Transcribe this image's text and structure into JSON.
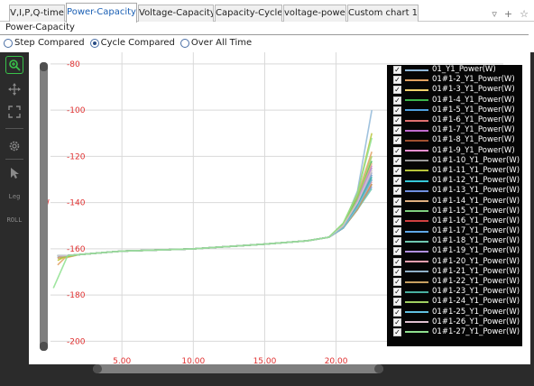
{
  "tabs": [
    "V,I,P,Q-time",
    "Power-Capacity",
    "Voltage-Capacity",
    "Capacity-Cycle",
    "voltage-power",
    "Custom chart 1"
  ],
  "active_tab": 1,
  "tab_tools": {
    "filter": "▿",
    "add": "+",
    "star": "☆"
  },
  "subtitle": "Power-Capacity",
  "radios": [
    {
      "label": "Step Compared",
      "checked": false
    },
    {
      "label": "Cycle Compared",
      "checked": true
    },
    {
      "label": "Over All Time",
      "checked": false
    }
  ],
  "toolbar": {
    "legend_label": "Leg",
    "roll_label": "ROLL"
  },
  "y_axis_label": "W",
  "colors": {
    "axis_label": "#e03030",
    "grid": "#d9d9d9",
    "legend_bg": "#050505",
    "zoom_tool": "#39c24a"
  },
  "chart_data": {
    "type": "line",
    "ylabel": "W",
    "xlim": [
      0,
      23.5
    ],
    "ylim": [
      -210,
      -75
    ],
    "x_ticks": [
      "5.00",
      "10.00",
      "15.00",
      "20.00"
    ],
    "y_ticks": [
      "-80",
      "-100",
      "-120",
      "-140",
      "-160",
      "-180",
      "-200"
    ],
    "series": [
      {
        "name": "01_Y1_Power(W)",
        "color": "#8fb7d8",
        "x": [
          0.5,
          1,
          2,
          5,
          10,
          15,
          18,
          19.5,
          20.5,
          21.5,
          22.5
        ],
        "y": [
          -163.5,
          -163,
          -162.5,
          -161,
          -160,
          -158,
          -156.5,
          -155,
          -150,
          -135,
          -100
        ]
      },
      {
        "name": "01#1-2_Y1_Power(W)",
        "color": "#e0a060",
        "x": [
          0.5,
          1,
          2,
          5,
          10,
          15,
          18,
          19.5,
          20.5,
          21.5,
          22.5
        ],
        "y": [
          -167,
          -164,
          -162.5,
          -161,
          -160,
          -158,
          -156.5,
          -155,
          -150,
          -137,
          -118
        ]
      },
      {
        "name": "01#1-3_Y1_Power(W)",
        "color": "#f2d16b",
        "x": [
          0.5,
          1,
          2,
          5,
          10,
          15,
          18,
          19.5,
          20.5,
          21.5,
          22.5
        ],
        "y": [
          -165,
          -163.5,
          -162.5,
          -161,
          -160,
          -158,
          -156.5,
          -155,
          -151,
          -140,
          -125
        ]
      },
      {
        "name": "01#1-4_Y1_Power(W)",
        "color": "#3cb44b",
        "x": [
          0.5,
          1,
          2,
          5,
          10,
          15,
          18,
          19.5,
          20.5,
          21.5,
          22.5
        ],
        "y": [
          -164,
          -163.5,
          -162.5,
          -161,
          -160,
          -158,
          -156.5,
          -155,
          -149,
          -138,
          -122
        ]
      },
      {
        "name": "01#1-5_Y1_Power(W)",
        "color": "#4fa0e0",
        "x": [
          0.5,
          1,
          2,
          5,
          10,
          15,
          18,
          19.5,
          20.5,
          21.5,
          22.5
        ],
        "y": [
          -163,
          -163,
          -162.5,
          -161,
          -160,
          -158,
          -156.5,
          -155,
          -150,
          -141,
          -130
        ]
      },
      {
        "name": "01#1-6_Y1_Power(W)",
        "color": "#e07070",
        "x": [
          0.5,
          1,
          2,
          5,
          10,
          15,
          18,
          19.5,
          20.5,
          21.5,
          22.5
        ],
        "y": [
          -163,
          -163,
          -162.5,
          -161,
          -160,
          -158,
          -156.5,
          -155,
          -151,
          -142,
          -128
        ]
      },
      {
        "name": "01#1-7_Y1_Power(W)",
        "color": "#c06bd0",
        "x": [
          0.5,
          1,
          2,
          5,
          10,
          15,
          18,
          19.5,
          20.5,
          21.5,
          22.5
        ],
        "y": [
          -164,
          -163,
          -162.5,
          -161,
          -160,
          -158,
          -156.5,
          -155,
          -150,
          -139,
          -124
        ]
      },
      {
        "name": "01#1-8_Y1_Power(W)",
        "color": "#a05030",
        "x": [
          0.5,
          1,
          2,
          5,
          10,
          15,
          18,
          19.5,
          20.5,
          21.5,
          22.5
        ],
        "y": [
          -164,
          -163,
          -162.5,
          -161,
          -160,
          -158,
          -156.5,
          -155,
          -151,
          -143,
          -132
        ]
      },
      {
        "name": "01#1-9_Y1_Power(W)",
        "color": "#f08fd0",
        "x": [
          0.5,
          1,
          2,
          5,
          10,
          15,
          18,
          19.5,
          20.5,
          21.5,
          22.5
        ],
        "y": [
          -163,
          -163,
          -162.5,
          -161,
          -160,
          -158,
          -156.5,
          -155,
          -150,
          -140,
          -127
        ]
      },
      {
        "name": "01#1-10_Y1_Power(W)",
        "color": "#9a9a9a",
        "x": [
          0.5,
          1,
          2,
          5,
          10,
          15,
          18,
          19.5,
          20.5,
          21.5,
          22.5
        ],
        "y": [
          -163,
          -163,
          -162.5,
          -161,
          -160,
          -158,
          -156.5,
          -155,
          -151,
          -142,
          -131
        ]
      },
      {
        "name": "01#1-11_Y1_Power(W)",
        "color": "#b8c43a",
        "x": [
          0.5,
          1,
          2,
          5,
          10,
          15,
          18,
          19.5,
          20.5,
          21.5,
          22.5
        ],
        "y": [
          -165,
          -163.5,
          -162.5,
          -161,
          -160,
          -158,
          -156.5,
          -155,
          -149,
          -136,
          -110
        ]
      },
      {
        "name": "01#1-12_Y1_Power(W)",
        "color": "#36c8d8",
        "x": [
          0.5,
          1,
          2,
          5,
          10,
          15,
          18,
          19.5,
          20.5,
          21.5,
          22.5
        ],
        "y": [
          -163,
          -163,
          -162.5,
          -161,
          -160,
          -158,
          -156.5,
          -155,
          -150,
          -141,
          -129
        ]
      },
      {
        "name": "01#1-13_Y1_Power(W)",
        "color": "#6f8fe0",
        "x": [
          0.5,
          1,
          2,
          5,
          10,
          15,
          18,
          19.5,
          20.5,
          21.5,
          22.5
        ],
        "y": [
          -163,
          -163,
          -162.5,
          -161,
          -160,
          -158,
          -156.5,
          -155,
          -151,
          -143,
          -133
        ]
      },
      {
        "name": "01#1-14_Y1_Power(W)",
        "color": "#e0b080",
        "x": [
          0.5,
          1,
          2,
          5,
          10,
          15,
          18,
          19.5,
          20.5,
          21.5,
          22.5
        ],
        "y": [
          -164,
          -163,
          -162.5,
          -161,
          -160,
          -158,
          -156.5,
          -155,
          -150,
          -139,
          -123
        ]
      },
      {
        "name": "01#1-15_Y1_Power(W)",
        "color": "#7fd07f",
        "x": [
          0.5,
          1,
          2,
          5,
          10,
          15,
          18,
          19.5,
          20.5,
          21.5,
          22.5
        ],
        "y": [
          -163,
          -163,
          -162.5,
          -161,
          -160,
          -158,
          -156.5,
          -155,
          -150,
          -140,
          -126
        ]
      },
      {
        "name": "01#1-16_Y1_Power(W)",
        "color": "#d04040",
        "x": [
          0.5,
          1,
          2,
          5,
          10,
          15,
          18,
          19.5,
          20.5,
          21.5,
          22.5
        ],
        "y": [
          -163,
          -163,
          -162.5,
          -161,
          -160,
          -158,
          -156.5,
          -155,
          -151,
          -142,
          -130
        ]
      },
      {
        "name": "01#1-17_Y1_Power(W)",
        "color": "#5fa8e8",
        "x": [
          0.5,
          1,
          2,
          5,
          10,
          15,
          18,
          19.5,
          20.5,
          21.5,
          22.5
        ],
        "y": [
          -163,
          -163,
          -162.5,
          -161,
          -160,
          -158,
          -156.5,
          -155,
          -150,
          -141,
          -128
        ]
      },
      {
        "name": "01#1-18_Y1_Power(W)",
        "color": "#6fc8b0",
        "x": [
          0.5,
          1,
          2,
          5,
          10,
          15,
          18,
          19.5,
          20.5,
          21.5,
          22.5
        ],
        "y": [
          -163,
          -163,
          -162.5,
          -161,
          -160,
          -158,
          -156.5,
          -155,
          -151,
          -143,
          -134
        ]
      },
      {
        "name": "01#1-19_Y1_Power(W)",
        "color": "#b08fe0",
        "x": [
          0.5,
          1,
          2,
          5,
          10,
          15,
          18,
          19.5,
          20.5,
          21.5,
          22.5
        ],
        "y": [
          -163,
          -163,
          -162.5,
          -161,
          -160,
          -158,
          -156.5,
          -155,
          -150,
          -139,
          -125
        ]
      },
      {
        "name": "01#1-20_Y1_Power(W)",
        "color": "#f0a0b0",
        "x": [
          0.5,
          1,
          2,
          5,
          10,
          15,
          18,
          19.5,
          20.5,
          21.5,
          22.5
        ],
        "y": [
          -163,
          -163,
          -162.5,
          -161,
          -160,
          -158,
          -156.5,
          -155,
          -151,
          -142,
          -131
        ]
      },
      {
        "name": "01#1-21_Y1_Power(W)",
        "color": "#90b0c8",
        "x": [
          0.5,
          1,
          2,
          5,
          10,
          15,
          18,
          19.5,
          20.5,
          21.5,
          22.5
        ],
        "y": [
          -163,
          -163,
          -162.5,
          -161,
          -160,
          -158,
          -156.5,
          -155,
          -150,
          -140,
          -127
        ]
      },
      {
        "name": "01#1-22_Y1_Power(W)",
        "color": "#c8a060",
        "x": [
          0.5,
          1,
          2,
          5,
          10,
          15,
          18,
          19.5,
          20.5,
          21.5,
          22.5
        ],
        "y": [
          -163,
          -163,
          -162.5,
          -161,
          -160,
          -158,
          -156.5,
          -155,
          -151,
          -143,
          -132
        ]
      },
      {
        "name": "01#1-23_Y1_Power(W)",
        "color": "#48b0a0",
        "x": [
          0.5,
          1,
          2,
          5,
          10,
          15,
          18,
          19.5,
          20.5,
          21.5,
          22.5
        ],
        "y": [
          -163,
          -163,
          -162.5,
          -161,
          -160,
          -158,
          -156.5,
          -155,
          -150,
          -141,
          -129
        ]
      },
      {
        "name": "01#1-24_Y1_Power(W)",
        "color": "#9fd060",
        "x": [
          0.5,
          1,
          2,
          5,
          10,
          15,
          18,
          19.5,
          20.5,
          21.5,
          22.5
        ],
        "y": [
          -163,
          -163,
          -162.5,
          -161,
          -160,
          -158,
          -156.5,
          -155,
          -150,
          -138,
          -120
        ]
      },
      {
        "name": "01#1-25_Y1_Power(W)",
        "color": "#60c0e0",
        "x": [
          0.5,
          1,
          2,
          5,
          10,
          15,
          18,
          19.5,
          20.5,
          21.5,
          22.5
        ],
        "y": [
          -163,
          -163,
          -162.5,
          -161,
          -160,
          -158,
          -156.5,
          -155,
          -151,
          -142,
          -130
        ]
      },
      {
        "name": "01#1-26_Y1_Power(W)",
        "color": "#e0c0d0",
        "x": [
          0.5,
          1,
          2,
          5,
          10,
          15,
          18,
          19.5,
          20.5,
          21.5,
          22.5
        ],
        "y": [
          -163,
          -163,
          -162.5,
          -161,
          -160,
          -158,
          -156.5,
          -155,
          -150,
          -140,
          -126
        ]
      },
      {
        "name": "01#1-27_Y1_Power(W)",
        "color": "#8ee08e",
        "x": [
          0.2,
          1.2,
          2,
          5,
          10,
          15,
          18,
          19.5,
          20.5,
          21.5,
          22.5
        ],
        "y": [
          -177,
          -163,
          -162.5,
          -161,
          -160,
          -158,
          -156.5,
          -155,
          -149,
          -136,
          -112
        ]
      }
    ]
  }
}
